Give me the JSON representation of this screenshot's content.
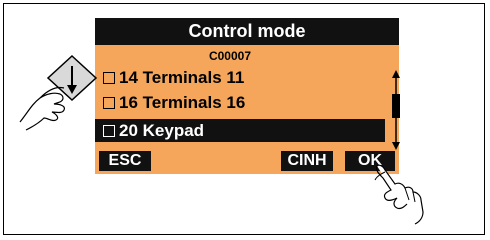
{
  "screen": {
    "title": "Control mode",
    "code": "C00007",
    "items": [
      {
        "label": "14 Terminals 11",
        "selected": false
      },
      {
        "label": "16 Terminals 16",
        "selected": false
      },
      {
        "label": "20 Keypad",
        "selected": true
      }
    ],
    "softkeys": {
      "esc": "ESC",
      "cinh": "CINH",
      "ok": "OK"
    }
  },
  "colors": {
    "screen_background": "#f5a65b",
    "bar": "#111111"
  },
  "icons": [
    "down-arrow-key-icon",
    "pointing-hand-icon",
    "scroll-arrows-icon"
  ]
}
